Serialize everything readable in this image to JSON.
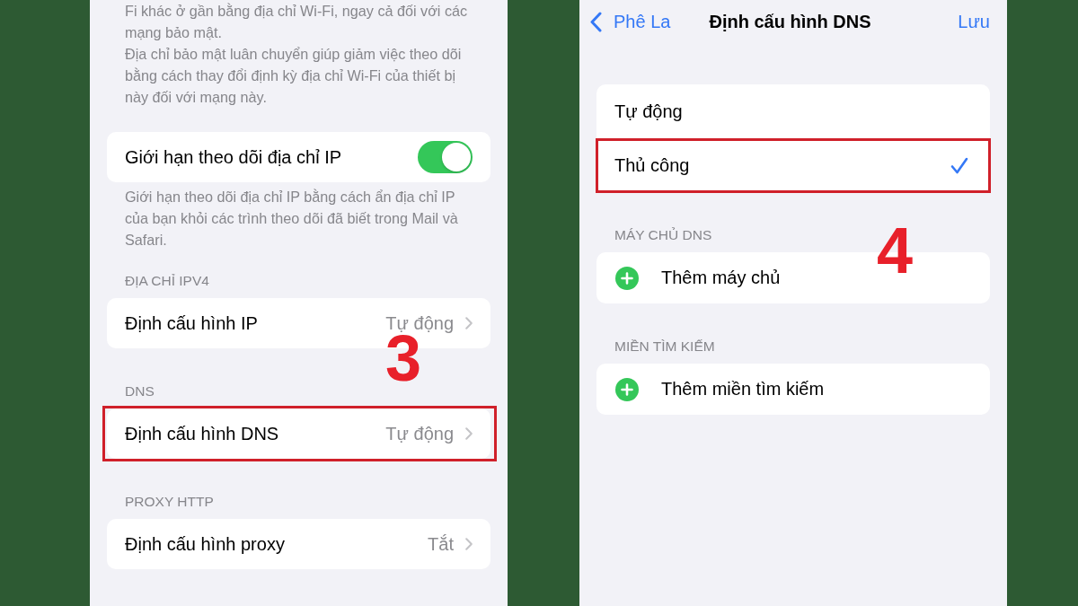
{
  "screens": [
    {
      "kind": "network_settings",
      "intro_notes": [
        "Fi khác ở gần bằng địa chỉ Wi-Fi, ngay cả đối với các mạng bảo mật.",
        "Địa chỉ bảo mật luân chuyển giúp giảm việc theo dõi bằng cách thay đổi định kỳ địa chỉ Wi-Fi của thiết bị này đối với mạng này."
      ],
      "groups": [
        {
          "rows": [
            {
              "kind": "toggle",
              "label": "Giới hạn theo dõi địa chỉ IP",
              "on": true,
              "highlighted": false
            }
          ],
          "footer": "Giới hạn theo dõi địa chỉ IP bằng cách ẩn địa chỉ IP của bạn khỏi các trình theo dõi đã biết trong Mail và Safari."
        },
        {
          "header": "ĐỊA CHỈ IPV4",
          "rows": [
            {
              "kind": "link",
              "label": "Định cấu hình IP",
              "value": "Tự động",
              "highlighted": false
            }
          ]
        },
        {
          "header": "DNS",
          "rows": [
            {
              "kind": "link",
              "label": "Định cấu hình DNS",
              "value": "Tự động",
              "highlighted": true
            }
          ]
        },
        {
          "header": "PROXY HTTP",
          "rows": [
            {
              "kind": "link",
              "label": "Định cấu hình proxy",
              "value": "Tắt",
              "highlighted": false
            }
          ]
        }
      ],
      "step_number": "3"
    },
    {
      "kind": "dns_config",
      "nav": {
        "back": "Phê La",
        "title": "Định cấu hình DNS",
        "action": "Lưu"
      },
      "groups": [
        {
          "rows": [
            {
              "kind": "option",
              "label": "Tự động",
              "selected": false,
              "highlighted": false
            },
            {
              "kind": "option",
              "label": "Thủ công",
              "selected": true,
              "highlighted": true
            }
          ]
        },
        {
          "header": "MÁY CHỦ DNS",
          "rows": [
            {
              "kind": "add",
              "label": "Thêm máy chủ",
              "highlighted": false
            }
          ]
        },
        {
          "header": "MIỀN TÌM KIẾM",
          "rows": [
            {
              "kind": "add",
              "label": "Thêm miền tìm kiếm",
              "highlighted": false
            }
          ]
        }
      ],
      "step_number": "4"
    }
  ]
}
